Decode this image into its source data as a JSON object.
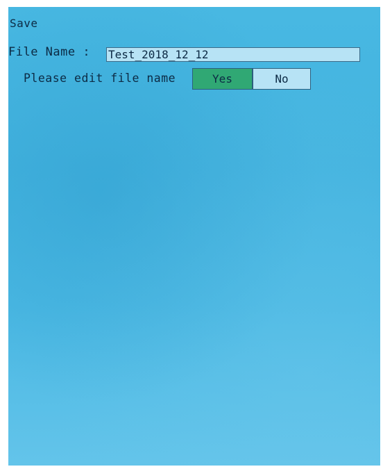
{
  "dialog": {
    "title": "Save",
    "filename_label": "File Name :",
    "filename_value": "Test_2018_12_12",
    "prompt": "Please edit file name",
    "yes_label": "Yes",
    "no_label": "No"
  },
  "colors": {
    "background": "#48b8e2",
    "input_background": "#b7e3f5",
    "selected_button": "#30a874",
    "text": "#0c2a44"
  }
}
